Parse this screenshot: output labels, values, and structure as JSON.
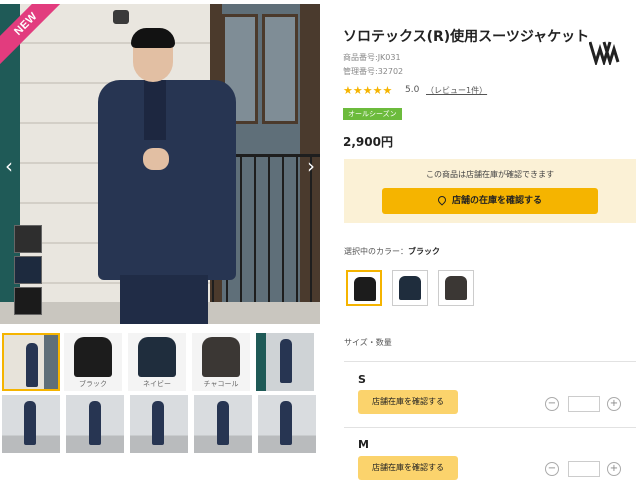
{
  "gallery": {
    "badge": "NEW",
    "prev_icon": "chevron-left-icon",
    "next_icon": "chevron-right-icon",
    "thumbnails": [
      {
        "caption": ""
      },
      {
        "caption": "ブラック"
      },
      {
        "caption": "ネイビー"
      },
      {
        "caption": "チャコール"
      },
      {
        "caption": ""
      }
    ]
  },
  "product": {
    "title": "ソロテックス(R)使用スーツジャケット",
    "product_no": "商品番号:JK031",
    "manage_no": "管理番号:32702",
    "stars": "★★★★★",
    "rating": "5.0",
    "review_link": "（レビュー1件）",
    "season_tag": "オールシーズン",
    "price": "2,900円"
  },
  "store": {
    "message": "この商品は店舗在庫が確認できます",
    "button": "店舗の在庫を確認する"
  },
  "color": {
    "label": "選択中のカラー：",
    "selected": "ブラック"
  },
  "sizes": {
    "label": "サイズ・数量",
    "items": [
      {
        "name": "S",
        "button": "店舗在庫を確認する",
        "minus": "−",
        "plus": "+"
      },
      {
        "name": "M",
        "button": "店舗在庫を確認する",
        "minus": "−",
        "plus": "+"
      }
    ]
  },
  "colors": {
    "accent": "#f5b400",
    "badge": "#e23c7e",
    "season": "#6cbb3c",
    "store_bg": "#fbf1d6"
  }
}
